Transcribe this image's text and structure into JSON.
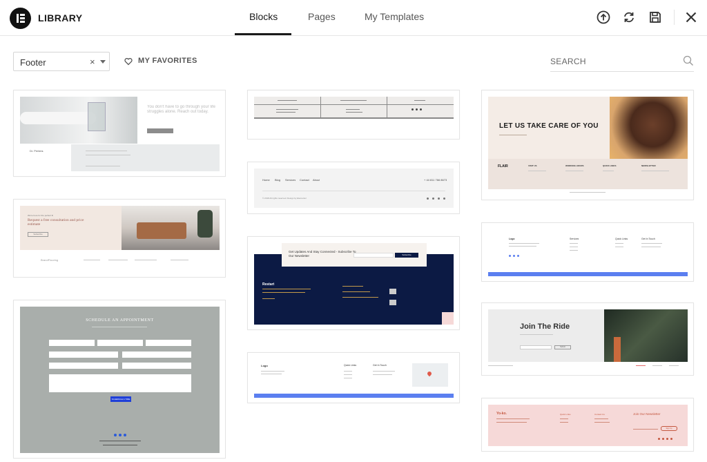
{
  "header": {
    "brand": "LIBRARY",
    "tabs": [
      {
        "label": "Blocks",
        "active": true
      },
      {
        "label": "Pages",
        "active": false
      },
      {
        "label": "My Templates",
        "active": false
      }
    ],
    "icons": [
      "upload-icon",
      "sync-icon",
      "save-icon",
      "close-icon"
    ]
  },
  "toolbar": {
    "category_value": "Footer",
    "clear_glyph": "×",
    "favorites_label": "MY FAVORITES",
    "search_placeholder": "SEARCH"
  },
  "colors": {
    "accent_blue": "#5b7ff0",
    "navy": "#0c1a44",
    "gray_form": "#a9aeab",
    "pink": "#f6d9d8",
    "beige": "#f4ece6"
  },
  "cards": {
    "c1": {
      "headline": "You don't have to go through your life struggles alone. Reach out today.",
      "name": "Dr. Perkins"
    },
    "c2": {
      "kicker": "We're here for the perfect fit",
      "headline": "Request a free consultation and price estimate",
      "button": "Subscribe",
      "brand": "BrandFlooring"
    },
    "c3": {
      "title": "SCHEDULE AN APPOINTMENT",
      "button": "SCHEDULE A TIME"
    },
    "c4": {},
    "c5": {
      "nav": [
        "Home",
        "Blog",
        "Services",
        "Contact",
        "About"
      ],
      "phone": "+ 44 811 766 8673",
      "copyright": "© 2018 All rights reserved. Design by Elementor"
    },
    "c6": {
      "headline": "Get Updates And Stay Connected - Subscribe To Our Newsletter",
      "button": "Subscribe",
      "footer_title": "Restart"
    },
    "c7": {
      "logo": "Logo",
      "col2": "Quick Links",
      "col3": "Get In Touch"
    },
    "c8": {
      "headline": "LET US TAKE CARE OF YOU",
      "brand": "FLAIR",
      "cols": [
        "VISIT US",
        "WORKING HOURS",
        "QUICK LINKS",
        "NEWSLETTER"
      ]
    },
    "c9": {
      "logo": "Logo",
      "cols": [
        "Services",
        "Quick Links",
        "Get In Touch"
      ]
    },
    "c10": {
      "headline": "Join The Ride",
      "button": "Submit"
    },
    "c11": {
      "brand": "Yo-ko.",
      "newsletter": "Join Our Newsletter",
      "button": "Sign Up",
      "cols": [
        "Quick Links",
        "Contact Us"
      ]
    }
  }
}
